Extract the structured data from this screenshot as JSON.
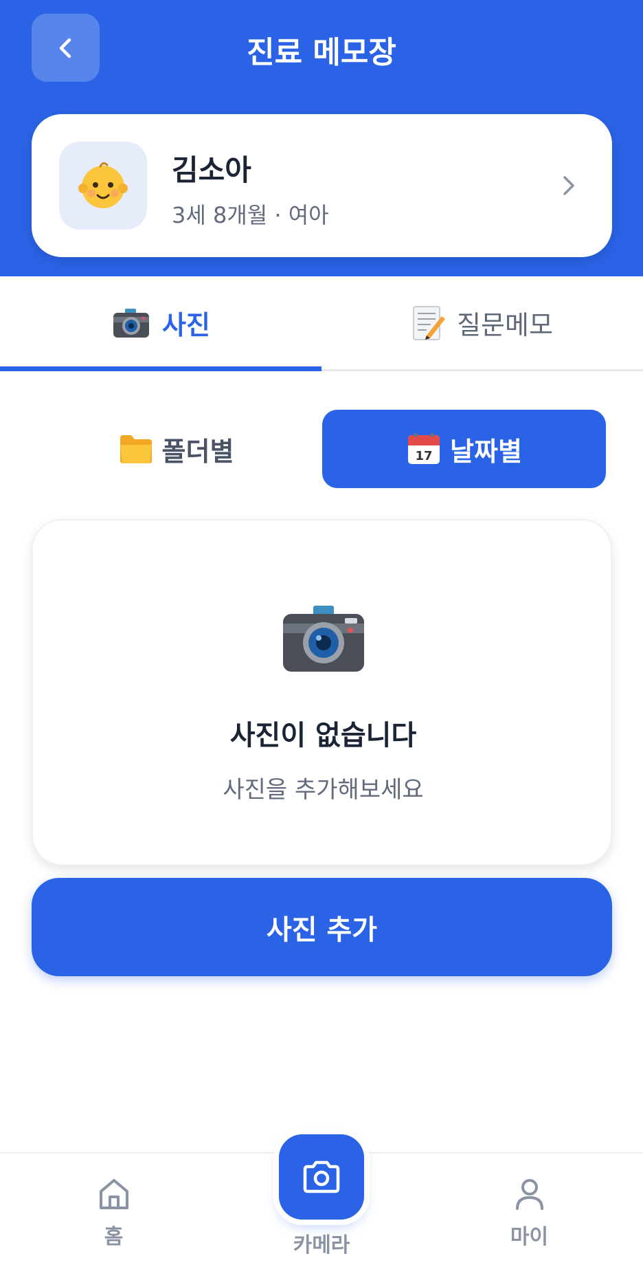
{
  "header": {
    "title": "진료 메모장"
  },
  "profile": {
    "name": "김소아",
    "info": "3세 8개월 · 여아",
    "avatar_icon": "baby-face-icon"
  },
  "tabs": [
    {
      "label": "사진",
      "icon": "camera-emoji",
      "active": true
    },
    {
      "label": "질문메모",
      "icon": "memo-emoji",
      "active": false
    }
  ],
  "segment": [
    {
      "label": "폴더별",
      "icon": "folder-emoji",
      "active": false
    },
    {
      "label": "날짜별",
      "icon": "calendar-emoji",
      "active": true
    }
  ],
  "empty_state": {
    "title": "사진이 없습니다",
    "subtitle": "사진을 추가해보세요",
    "icon": "camera-emoji"
  },
  "add_button": {
    "label": "사진 추가"
  },
  "bottom_nav": {
    "home": {
      "label": "홈",
      "icon": "home-icon"
    },
    "camera": {
      "label": "카메라",
      "icon": "camera-icon"
    },
    "my": {
      "label": "마이",
      "icon": "person-icon"
    }
  },
  "colors": {
    "primary": "#2a63e6",
    "background": "#ffffff",
    "muted_text": "#616b7d"
  }
}
